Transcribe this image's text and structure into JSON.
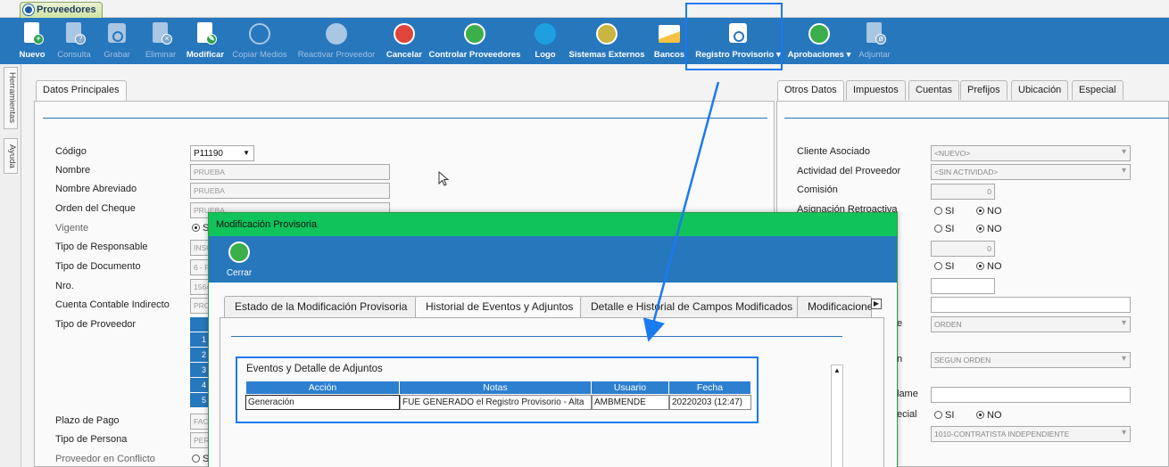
{
  "app_tab": {
    "title": "Proveedores"
  },
  "toolbar": {
    "nuevo": "Nuevo",
    "consulta": "Consulta",
    "grabar": "Grabar",
    "eliminar": "Eliminar",
    "modificar": "Modificar",
    "copiar": "Copiar Medios",
    "reactivar": "Reactivar Proveedor",
    "cancelar": "Cancelar",
    "controlar": "Controlar Proveedores",
    "logo": "Logo",
    "sistemas": "Sistemas Externos",
    "bancos": "Bancos",
    "registro": "Registro Provisorio",
    "aprobaciones": "Aprobaciones",
    "adjuntar": "Adjuntar"
  },
  "side_tabs": {
    "herramientas": "Herramientas",
    "ayuda": "Ayuda"
  },
  "left_panel": {
    "tab": "Datos Principales",
    "labels": {
      "codigo": "Código",
      "nombre": "Nombre",
      "nombre_abreviado": "Nombre Abreviado",
      "orden_cheque": "Orden del Cheque",
      "vigente": "Vigente",
      "tipo_responsable": "Tipo de Responsable",
      "tipo_documento": "Tipo de Documento",
      "nro": "Nro.",
      "cuenta_contable": "Cuenta Contable Indirecto",
      "tipo_proveedor": "Tipo de Proveedor",
      "plazo_pago": "Plazo de Pago",
      "tipo_persona": "Tipo de Persona",
      "conflicto": "Proveedor en Conflicto"
    },
    "values": {
      "codigo": "P11190",
      "nombre": "PRUEBA",
      "nombre_abreviado": "PRUEBA",
      "orden_cheque": "PRUEBA",
      "tipo_responsable": "INSC",
      "tipo_documento": "6 - R",
      "nro": "1564",
      "cuenta_contable": "PRO",
      "plazo_pago": "FAC",
      "tipo_persona": "PER"
    },
    "tipo_proveedor_items": [
      "1",
      "2",
      "3",
      "4",
      "5"
    ],
    "radio_vigente": "S",
    "radio_conflicto": "S"
  },
  "right_panel": {
    "tabs": [
      "Otros Datos",
      "Impuestos",
      "Cuentas",
      "Prefijos",
      "Ubicación",
      "Especial"
    ],
    "labels": {
      "cliente": "Cliente Asociado",
      "actividad": "Actividad del Proveedor",
      "comision": "Comisión",
      "asignacion": "Asignación Retroactiva",
      "partial_e": "e",
      "partial_n": "n",
      "partial_lame": "lame",
      "partial_ecial": "ecial"
    },
    "values": {
      "cliente": "<NUEVO>",
      "actividad": "<SIN ACTIVIDAD>",
      "comision": "0",
      "num2": "0",
      "orden": "ORDEN",
      "segun_orden": "SEGUN ORDEN",
      "contratista": "1010-CONTRATISTA INDEPENDIENTE"
    },
    "radio_si": "SI",
    "radio_no": "NO"
  },
  "modal": {
    "title": "Modificación Provisoria",
    "close": "Cerrar",
    "tabs": [
      "Estado de la Modificación Provisoria",
      "Historial de Eventos y Adjuntos",
      "Detalle e Historial de Campos Modificados",
      "Modificacione"
    ],
    "section_title": "Eventos y Detalle de Adjuntos",
    "columns": [
      "Acción",
      "Notas",
      "Usuario",
      "Fecha"
    ],
    "rows": [
      {
        "accion": "Generación",
        "notas": "FUE GENERADO el Registro Provisorio - Alta",
        "usuario": "AMBMENDE",
        "fecha": "20220203 (12:47)"
      }
    ]
  },
  "colors": {
    "toolbar_blue": "#2777bd",
    "modal_title_green": "#10c35a",
    "highlight": "#1a7af0",
    "grid_header": "#2d7fd0"
  }
}
